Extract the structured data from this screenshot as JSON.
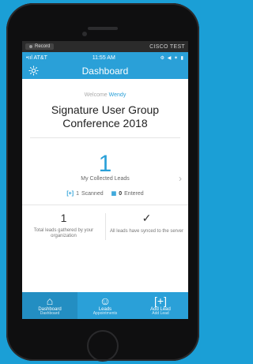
{
  "recording": {
    "button_label": "Record",
    "brand": "CISCO TEST"
  },
  "status_bar": {
    "carrier": "AT&T",
    "time": "11:55 AM",
    "icons": "⚙ ◀ ✶ ▮"
  },
  "nav": {
    "title": "Dashboard",
    "settings_icon": "gear-icon"
  },
  "welcome": {
    "prefix": "Welcome",
    "name": "Wendy"
  },
  "event": {
    "name": "Signature User Group Conference 2018"
  },
  "leads": {
    "count": "1",
    "label": "My Collected Leads",
    "scanned": {
      "icon": "[+]",
      "value": "1",
      "label": "Scanned"
    },
    "entered": {
      "icon": "▦",
      "value": "0",
      "label": "Entered"
    }
  },
  "summary": {
    "total": "1",
    "total_label": "Total leads gathered by your organization",
    "sync_icon": "✓",
    "sync_label": "All leads have synced to the server"
  },
  "tabs": [
    {
      "label": "Dashboard",
      "sub": "Dashboard",
      "icon": "home-icon"
    },
    {
      "label": "Leads",
      "sub": "Appointments",
      "icon": "people-icon"
    },
    {
      "label": "Add Lead",
      "sub": "Add Lead",
      "icon": "scan-icon"
    }
  ],
  "colors": {
    "accent": "#2aa0d8",
    "background": "#1b9fd6"
  }
}
